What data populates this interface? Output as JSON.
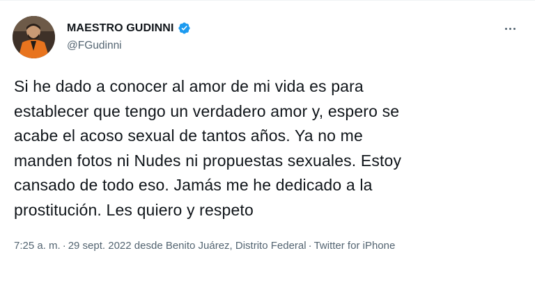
{
  "author": {
    "display_name": "MAESTRO GUDINNI",
    "handle": "@FGudinni",
    "verified": true,
    "avatar_icon": "profile-photo"
  },
  "more_icon": "more-horizontal-icon",
  "tweet": {
    "text": "Si he dado a conocer al amor de mi vida es para\nestablecer que tengo un verdadero amor y, espero se\nacabe el acoso sexual de tantos años. Ya no me\nmanden fotos ni Nudes ni propuestas sexuales. Estoy\ncansado de todo eso. Jamás me he dedicado a la\nprostitución. Les quiero y respeto"
  },
  "meta": {
    "time": "7:25 a. m.",
    "date": "29 sept. 2022",
    "location": "desde Benito Juárez, Distrito Federal",
    "source": "Twitter for iPhone",
    "separator": "·"
  },
  "colors": {
    "text": "#0f1419",
    "secondary": "#536471",
    "verified": "#1d9bf0"
  }
}
